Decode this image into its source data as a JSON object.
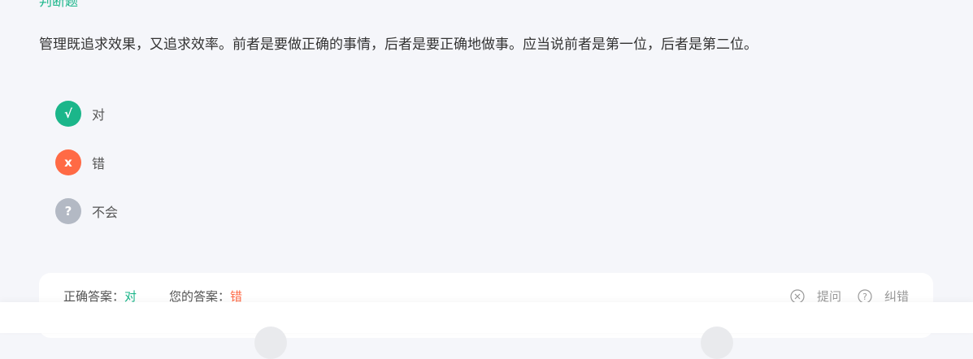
{
  "question": {
    "type_label": "判断题",
    "text": "管理既追求效果，又追求效率。前者是要做正确的事情，后者是要正确地做事。应当说前者是第一位，后者是第二位。"
  },
  "options": [
    {
      "mark": "√",
      "label": "对",
      "color": "#1bb68a"
    },
    {
      "mark": "x",
      "label": "错",
      "color": "#ff6a45"
    },
    {
      "mark": "?",
      "label": "不会",
      "color": "#b3b9c4"
    }
  ],
  "answer": {
    "correct_label": "正确答案：",
    "correct_value": "对",
    "user_label": "您的答案：",
    "user_value": "错"
  },
  "tools": {
    "ask_label": "提问",
    "ask_icon": "close-circle-icon",
    "report_label": "纠错",
    "report_icon": "question-circle-icon"
  }
}
